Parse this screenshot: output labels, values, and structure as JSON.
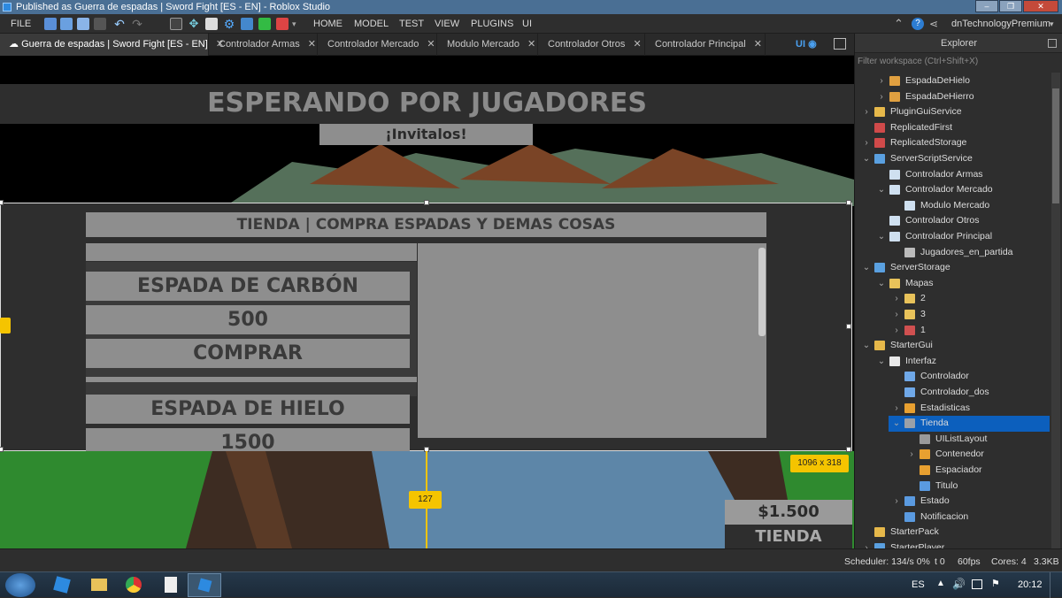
{
  "window": {
    "title": "Published as Guerra de espadas | Sword Fight [ES - EN] - Roblox Studio"
  },
  "menu": {
    "file": "FILE",
    "items": [
      "HOME",
      "MODEL",
      "TEST",
      "VIEW",
      "PLUGINS",
      "UI"
    ],
    "user": "dnTechnologyPremium"
  },
  "tabs": [
    {
      "label": "Guerra de espadas | Sword Fight [ES - EN]"
    },
    {
      "label": "Controlador Armas"
    },
    {
      "label": "Controlador Mercado"
    },
    {
      "label": "Modulo Mercado"
    },
    {
      "label": "Controlador Otros"
    },
    {
      "label": "Controlador Principal"
    }
  ],
  "ui_toggle": "UI",
  "game": {
    "waiting_title": "ESPERANDO POR JUGADORES",
    "invite": "¡Invitalos!",
    "shop_title": "TIENDA | COMPRA ESPADAS Y DEMAS COSAS",
    "items": [
      {
        "name": "ESPADA DE CARBÓN",
        "price": "500",
        "buy": "COMPRAR"
      },
      {
        "name": "ESPADA DE HIELO",
        "price": "1500"
      }
    ],
    "size_badge": "1096 x 318",
    "offset_badge": "127",
    "money": "$1.500",
    "shop_button": "TIENDA"
  },
  "explorer": {
    "title": "Explorer",
    "filter_placeholder": "Filter workspace (Ctrl+Shift+X)",
    "rows": [
      {
        "label": "EspadaDeHielo",
        "depth": 1,
        "chev": "›",
        "icon": "tool",
        "color": "#e0a040"
      },
      {
        "label": "EspadaDeHierro",
        "depth": 1,
        "chev": "›",
        "icon": "tool",
        "color": "#e0a040"
      },
      {
        "label": "PluginGuiService",
        "depth": 0,
        "chev": "›",
        "icon": "gui",
        "color": "#e6b84a"
      },
      {
        "label": "ReplicatedFirst",
        "depth": 0,
        "chev": "",
        "icon": "box",
        "color": "#d04a4a"
      },
      {
        "label": "ReplicatedStorage",
        "depth": 0,
        "chev": "›",
        "icon": "box",
        "color": "#d04a4a"
      },
      {
        "label": "ServerScriptService",
        "depth": 0,
        "chev": "⌄",
        "icon": "service",
        "color": "#5aa0e0"
      },
      {
        "label": "Controlador Armas",
        "depth": 1,
        "chev": "",
        "icon": "script",
        "color": "#cfe0f0"
      },
      {
        "label": "Controlador Mercado",
        "depth": 1,
        "chev": "⌄",
        "icon": "script",
        "color": "#cfe0f0"
      },
      {
        "label": "Modulo Mercado",
        "depth": 2,
        "chev": "",
        "icon": "module",
        "color": "#cfe0f0"
      },
      {
        "label": "Controlador Otros",
        "depth": 1,
        "chev": "",
        "icon": "script",
        "color": "#cfe0f0"
      },
      {
        "label": "Controlador Principal",
        "depth": 1,
        "chev": "⌄",
        "icon": "script",
        "color": "#cfe0f0"
      },
      {
        "label": "Jugadores_en_partida",
        "depth": 2,
        "chev": "",
        "icon": "value",
        "color": "#bbbbbb"
      },
      {
        "label": "ServerStorage",
        "depth": 0,
        "chev": "⌄",
        "icon": "service",
        "color": "#5aa0e0"
      },
      {
        "label": "Mapas",
        "depth": 1,
        "chev": "⌄",
        "icon": "folder",
        "color": "#e8c25a"
      },
      {
        "label": "2",
        "depth": 2,
        "chev": "›",
        "icon": "folder",
        "color": "#e8c25a"
      },
      {
        "label": "3",
        "depth": 2,
        "chev": "›",
        "icon": "folder",
        "color": "#e8c25a"
      },
      {
        "label": "1",
        "depth": 2,
        "chev": "›",
        "icon": "model",
        "color": "#d05050"
      },
      {
        "label": "StarterGui",
        "depth": 0,
        "chev": "⌄",
        "icon": "gui",
        "color": "#e6b84a"
      },
      {
        "label": "Interfaz",
        "depth": 1,
        "chev": "⌄",
        "icon": "screengui",
        "color": "#e8e8e8"
      },
      {
        "label": "Controlador",
        "depth": 2,
        "chev": "",
        "icon": "localscript",
        "color": "#6fa8e8"
      },
      {
        "label": "Controlador_dos",
        "depth": 2,
        "chev": "",
        "icon": "localscript",
        "color": "#6fa8e8"
      },
      {
        "label": "Estadisticas",
        "depth": 2,
        "chev": "›",
        "icon": "frame",
        "color": "#e8a030"
      },
      {
        "label": "Tienda",
        "depth": 2,
        "chev": "⌄",
        "icon": "frame",
        "color": "#9aa0a8",
        "selected": true
      },
      {
        "label": "UIListLayout",
        "depth": 3,
        "chev": "",
        "icon": "layout",
        "color": "#9a9a9a"
      },
      {
        "label": "Contenedor",
        "depth": 3,
        "chev": "›",
        "icon": "frame",
        "color": "#e8a030"
      },
      {
        "label": "Espaciador",
        "depth": 3,
        "chev": "",
        "icon": "frame",
        "color": "#e8a030"
      },
      {
        "label": "Titulo",
        "depth": 3,
        "chev": "",
        "icon": "textlabel",
        "color": "#5a9ae0"
      },
      {
        "label": "Estado",
        "depth": 2,
        "chev": "›",
        "icon": "textlabel",
        "color": "#5a9ae0"
      },
      {
        "label": "Notificacion",
        "depth": 2,
        "chev": "",
        "icon": "textlabel",
        "color": "#5a9ae0"
      },
      {
        "label": "StarterPack",
        "depth": 0,
        "chev": "",
        "icon": "gui",
        "color": "#e6b84a"
      },
      {
        "label": "StarterPlayer",
        "depth": 0,
        "chev": "›",
        "icon": "service",
        "color": "#5aa0e0"
      }
    ]
  },
  "status": {
    "scheduler": "Scheduler: 134/s 0%",
    "t": "t 0",
    "fps": "60fps",
    "cores": "Cores: 4",
    "size": "3.3KB"
  },
  "taskbar": {
    "lang": "ES",
    "time": "20:12"
  }
}
